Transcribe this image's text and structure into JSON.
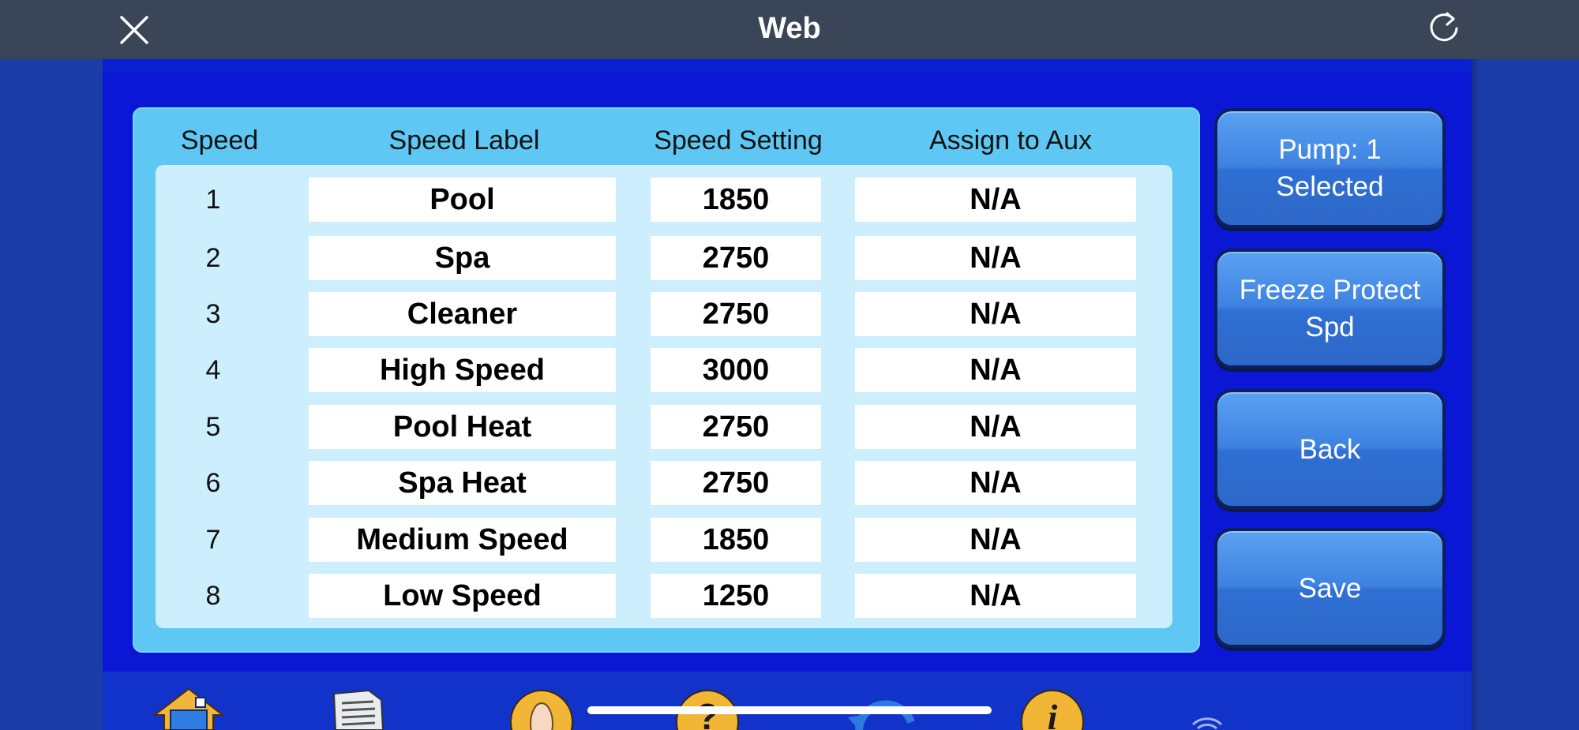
{
  "topbar": {
    "title": "Web"
  },
  "table": {
    "headers": {
      "speed": "Speed",
      "label": "Speed Label",
      "setting": "Speed Setting",
      "aux": "Assign to Aux"
    },
    "rows": [
      {
        "speed": "1",
        "label": "Pool",
        "setting": "1850",
        "aux": "N/A"
      },
      {
        "speed": "2",
        "label": "Spa",
        "setting": "2750",
        "aux": "N/A"
      },
      {
        "speed": "3",
        "label": "Cleaner",
        "setting": "2750",
        "aux": "N/A"
      },
      {
        "speed": "4",
        "label": "High Speed",
        "setting": "3000",
        "aux": "N/A"
      },
      {
        "speed": "5",
        "label": "Pool Heat",
        "setting": "2750",
        "aux": "N/A"
      },
      {
        "speed": "6",
        "label": "Spa Heat",
        "setting": "2750",
        "aux": "N/A"
      },
      {
        "speed": "7",
        "label": "Medium Speed",
        "setting": "1850",
        "aux": "N/A"
      },
      {
        "speed": "8",
        "label": "Low Speed",
        "setting": "1250",
        "aux": "N/A"
      }
    ]
  },
  "actions": {
    "pump_line1": "Pump: 1",
    "pump_line2": "Selected",
    "freeze_line1": "Freeze Protect",
    "freeze_line2": "Spd",
    "back": "Back",
    "save": "Save"
  },
  "toolbar": {
    "icons": [
      "home-icon",
      "document-icon",
      "hand-icon",
      "help-icon",
      "refresh-arrow-icon",
      "info-icon",
      "wifi-icon"
    ]
  },
  "colors": {
    "background": "#1d3fae",
    "app": "#0a18d6",
    "panel": "#5fc7f3",
    "panel_inner": "#cdeffd",
    "button": "#3e82e0",
    "topbar": "#3b4558"
  }
}
